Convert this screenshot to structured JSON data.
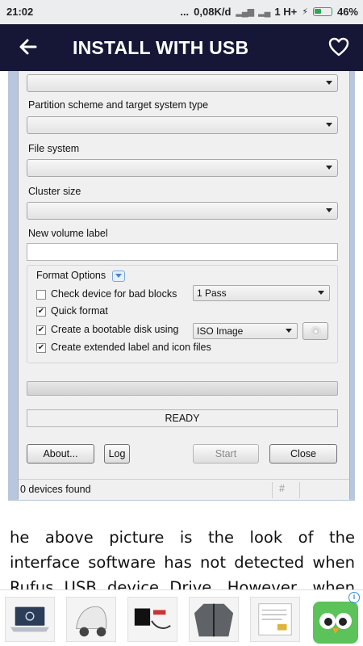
{
  "status_bar": {
    "time": "21:02",
    "dots": "...",
    "network_speed": "0,08K/d",
    "sim": "1 H+",
    "battery": "46%"
  },
  "app_bar": {
    "title": "INSTALL WITH USB",
    "back_icon": "arrow-left-icon",
    "favorite_icon": "heart-outline-icon"
  },
  "rufus": {
    "partition_label": "Partition scheme and target system type",
    "file_system_label": "File system",
    "cluster_size_label": "Cluster size",
    "volume_label_label": "New volume label",
    "format_options_label": "Format Options",
    "check_bad_blocks_label": "Check device for bad blocks",
    "check_bad_blocks_checked": false,
    "passes_value": "1 Pass",
    "quick_format_label": "Quick format",
    "quick_format_checked": true,
    "bootable_label": "Create a bootable disk using",
    "bootable_checked": true,
    "bootable_value": "ISO Image",
    "extended_label_label": "Create extended label and icon files",
    "extended_label_checked": true,
    "status_text": "READY",
    "about_button": "About...",
    "log_button": "Log",
    "start_button": "Start",
    "close_button": "Close",
    "devices_found": "0 devices found",
    "hash_symbol": "#"
  },
  "article": {
    "line1": "he above picture is the look of the",
    "line2": "interface software has not detected when",
    "line3": "Rufus USB device Drive. However, when"
  },
  "ads": {
    "adchoices_icon": "adchoices-icon",
    "items": [
      "laptop",
      "scooter",
      "electronics-kit",
      "jacket",
      "document",
      "owl-app"
    ]
  },
  "colors": {
    "app_bar_bg": "#161636",
    "status_bar_bg": "#ecedef",
    "window_bg": "#f0f0f0",
    "battery_green": "#2fa84f"
  }
}
